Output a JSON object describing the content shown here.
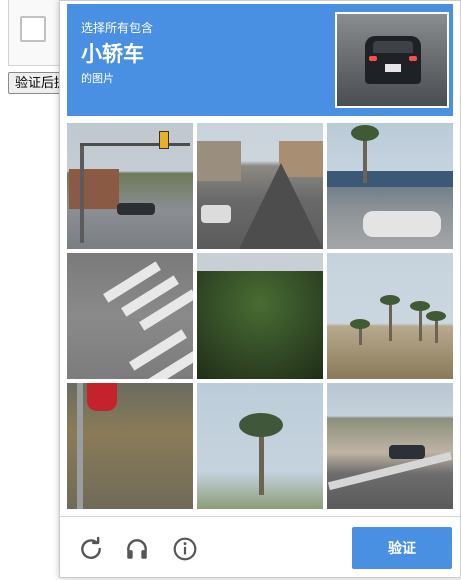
{
  "background": {
    "button_label": "验证后提交"
  },
  "challenge": {
    "instruction_line1": "选择所有包含",
    "target_object": "小轿车",
    "instruction_line3": "的图片",
    "header_color": "#4a90e2"
  },
  "grid": {
    "rows": 3,
    "cols": 3,
    "tiles": [
      {
        "content": "street-intersection-traffic-light"
      },
      {
        "content": "residential-street-parked-cars"
      },
      {
        "content": "white-car-parking-lot-palm"
      },
      {
        "content": "crosswalk-stripes"
      },
      {
        "content": "palm-tree-closeup"
      },
      {
        "content": "hillside-palm-trees"
      },
      {
        "content": "sidewalk-red-fire-hydrant"
      },
      {
        "content": "tall-palm-tree-sky"
      },
      {
        "content": "freeway-with-car"
      }
    ]
  },
  "footer": {
    "icons": [
      "reload-icon",
      "audio-icon",
      "info-icon"
    ],
    "verify_label": "验证",
    "verify_color": "#4a90e2"
  }
}
